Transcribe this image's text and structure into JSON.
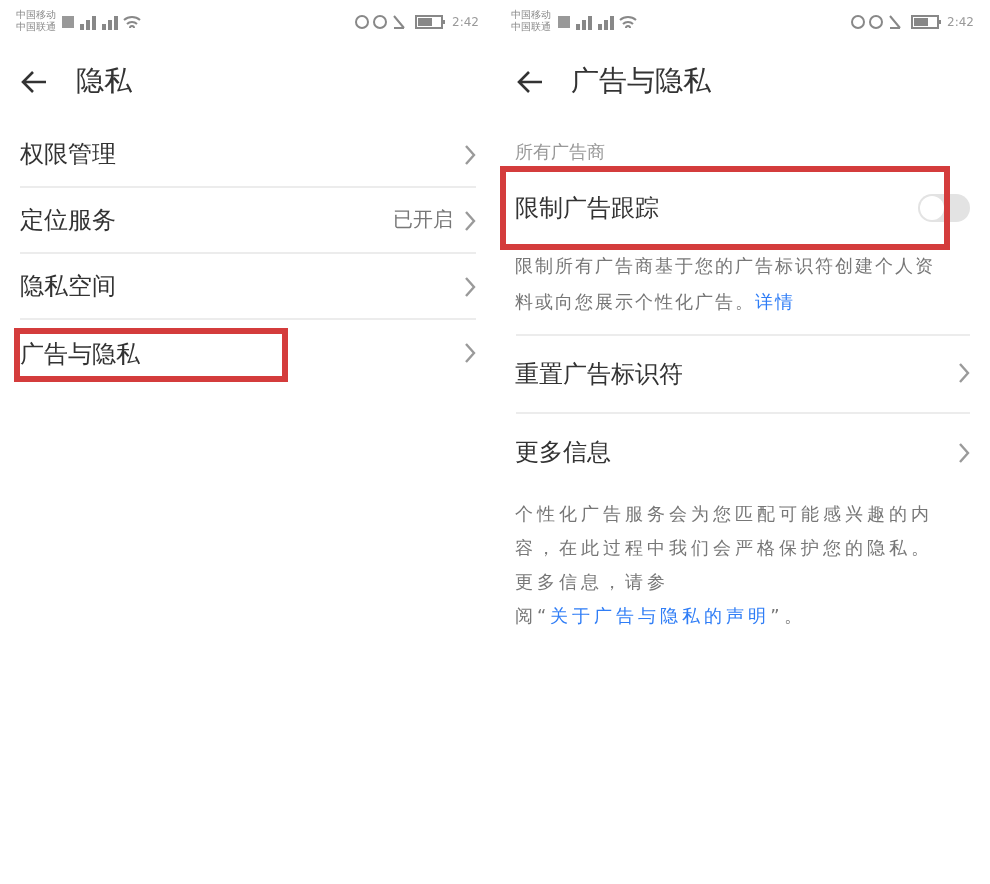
{
  "screens": [
    {
      "status_bar": {
        "carriers": [
          "中国移动",
          "中国联通"
        ],
        "time": "2:42"
      },
      "header": {
        "title": "隐私"
      },
      "items": [
        {
          "label": "权限管理",
          "highlighted": false
        },
        {
          "label": "定位服务",
          "value": "已开启",
          "highlighted": false
        },
        {
          "label": "隐私空间",
          "highlighted": false
        },
        {
          "label": "广告与隐私",
          "highlighted": true
        }
      ]
    },
    {
      "status_bar": {
        "carriers": [
          "中国移动",
          "中国联通"
        ],
        "time": "2:42"
      },
      "header": {
        "title": "广告与隐私"
      },
      "section_label": "所有广告商",
      "toggle": {
        "label": "限制广告跟踪",
        "on": false,
        "highlighted": true,
        "description": "限制所有广告商基于您的广告标识符创建个人资料或向您展示个性化广告。",
        "link": "详情"
      },
      "items": [
        {
          "label": "重置广告标识符",
          "highlighted": false
        },
        {
          "label": "更多信息",
          "highlighted": false
        }
      ],
      "footnote": {
        "text": "个性化广告服务会为您匹配可能感兴趣的内容，在此过程中我们会严格保护您的隐私。更多信息，请参阅“",
        "link": "关于广告与隐私的声明",
        "tail": "”。"
      }
    }
  ]
}
